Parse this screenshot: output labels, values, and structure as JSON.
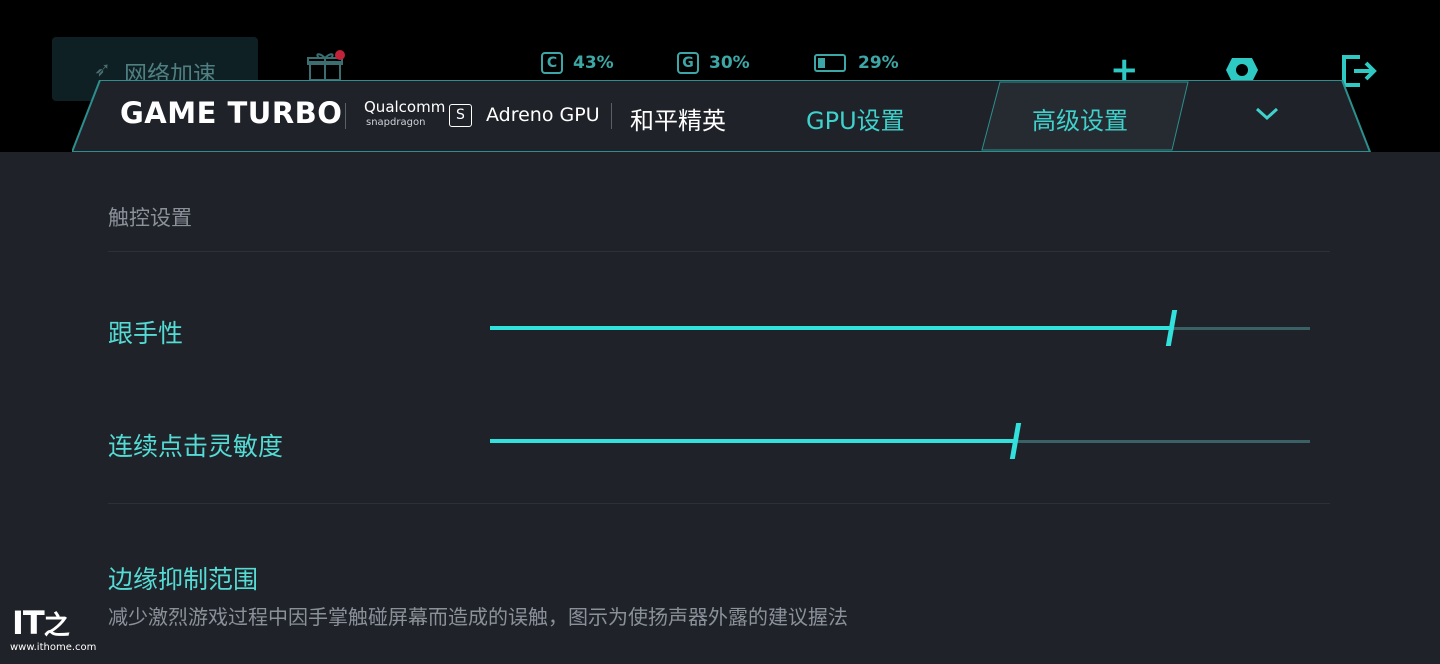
{
  "top": {
    "network_label": "网络加速",
    "stats": [
      {
        "icon": "C",
        "value": "43%"
      },
      {
        "icon": "G",
        "value": "30%"
      },
      {
        "icon": "battery",
        "value": "29%"
      }
    ]
  },
  "header": {
    "title": "GAME TURBO",
    "qualcomm": "Qualcomm",
    "snapdragon": "snapdragon",
    "gpu_name": "Adreno GPU",
    "game_name": "和平精英",
    "tabs": [
      {
        "label": "GPU设置",
        "active": false
      },
      {
        "label": "高级设置",
        "active": true
      }
    ]
  },
  "content": {
    "section_title": "触控设置",
    "sliders": [
      {
        "label": "跟手性",
        "value": 0.83
      },
      {
        "label": "连续点击灵敏度",
        "value": 0.64
      }
    ],
    "edge_title": "边缘抑制范围",
    "edge_desc": "减少激烈游戏过程中因手掌触碰屏幕而造成的误触，图示为使扬声器外露的建议握法"
  },
  "watermark": {
    "logo": "IT之家",
    "url": "www.ithome.com"
  },
  "colors": {
    "accent": "#32e0dc",
    "background": "#1f2229",
    "text_muted": "#8a9198"
  }
}
